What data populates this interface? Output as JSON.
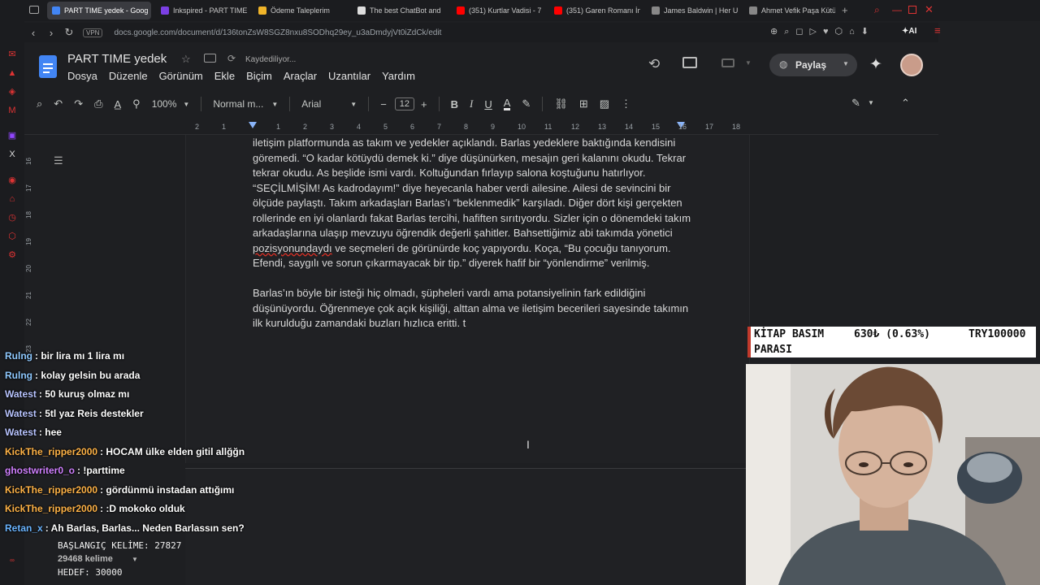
{
  "tabs": [
    {
      "label": "PART TIME yedek - Goog",
      "color": "#4285f4",
      "active": true
    },
    {
      "label": "Inkspired - PART TIME",
      "color": "#7b3fe4",
      "active": false
    },
    {
      "label": "Ödeme Taleplerim",
      "color": "#f0b429",
      "active": false
    },
    {
      "label": "The best ChatBot and",
      "color": "#dddddd",
      "active": false
    },
    {
      "label": "(351) Kurtlar Vadisi - 7",
      "color": "#ff0000",
      "active": false
    },
    {
      "label": "(351) Garen Romanı İn",
      "color": "#ff0000",
      "active": false
    },
    {
      "label": "James Baldwin | Her U",
      "color": "#888888",
      "active": false
    },
    {
      "label": "Ahmet Vefik Paşa Kütü",
      "color": "#888888",
      "active": false
    }
  ],
  "address": {
    "vpn": "VPN",
    "url": "docs.google.com/document/d/136tonZsW8SGZ8nxu8SODhq29ey_u3aDmdyjVt0iZdCk/edit"
  },
  "docs": {
    "title": "PART TIME  yedek",
    "saving": "Kaydediliyor...",
    "menus": [
      "Dosya",
      "Düzenle",
      "Görünüm",
      "Ekle",
      "Biçim",
      "Araçlar",
      "Uzantılar",
      "Yardım"
    ],
    "share": "Paylaş",
    "zoom": "100%",
    "style": "Normal m...",
    "font": "Arial",
    "fontsize": "12"
  },
  "ruler": [
    "2",
    "1",
    "1",
    "2",
    "3",
    "4",
    "5",
    "6",
    "7",
    "8",
    "9",
    "10",
    "11",
    "12",
    "13",
    "14",
    "15",
    "16",
    "17",
    "18"
  ],
  "vruler": [
    "16",
    "17",
    "18",
    "19",
    "20",
    "21",
    "22",
    "23"
  ],
  "text": {
    "p1": "iletişim platformunda as takım ve yedekler açıklandı. Barlas yedeklere baktığında kendisini göremedi. “O kadar kötüydü demek ki.” diye düşünürken, mesajın geri kalanını okudu. Tekrar tekrar okudu. As beşlide ismi vardı. Koltuğundan fırlayıp salona koştuğunu hatırlıyor. “SEÇİLMİŞİM! As kadrodayım!” diye heyecanla haber verdi ailesine. Ailesi de sevincini bir ölçüde paylaştı. Takım arkadaşları Barlas’ı “beklenmedik” karşıladı. Diğer dört kişi gerçekten rollerinde en iyi olanlardı fakat Barlas tercihi, hafiften sırıtıyordu. Sizler için o dönemdeki takım arkadaşlarına ulaşıp mevzuyu öğrendik değerli şahitler. Bahsettiğimiz abi takımda yönetici",
    "p1_squiggle": "pozisyonundaydı",
    "p1_rest": " ve seçmeleri de görünürde koç yapıyordu. Koça, “Bu çocuğu tanıyorum. Efendi, saygılı ve sorun çıkarmayacak bir tip.” diyerek hafif bir “yönlendirme” verilmiş.",
    "p2": "Barlas’ın böyle bir isteği hiç olmadı, şüpheleri vardı ama potansiyelinin fark edildiğini düşünüyordu. Öğrenmeye çok açık kişiliği, alttan alma ve iletişim becerileri sayesinde takımın ilk kurulduğu zamandaki buzları hızlıca eritti. t"
  },
  "chat": [
    {
      "user": "Rulng",
      "color": "#8fc9ff",
      "msg": ": bir lira mı 1 lira mı"
    },
    {
      "user": "Rulng",
      "color": "#8fc9ff",
      "msg": ": kolay gelsin bu arada"
    },
    {
      "user": "Watest",
      "color": "#b8c4ff",
      "msg": ": 50 kuruş olmaz mı"
    },
    {
      "user": "Watest",
      "color": "#b8c4ff",
      "msg": ": 5tl yaz Reis destekler"
    },
    {
      "user": "Watest",
      "color": "#b8c4ff",
      "msg": ": hee"
    },
    {
      "user": "KickThe_ripper2000",
      "color": "#ffb347",
      "msg": ": HOCAM ülke elden gitil allğğn"
    },
    {
      "user": "ghostwriter0_o",
      "color": "#d080ff",
      "msg": ": !parttime"
    },
    {
      "user": "KickThe_ripper2000",
      "color": "#ffb347",
      "msg": ": gördünmü instadan attığımı"
    },
    {
      "user": "KickThe_ripper2000",
      "color": "#ffb347",
      "msg": ": :D mokoko olduk"
    },
    {
      "user": "Retan_x",
      "color": "#6ab4ff",
      "msg": ": Ah Barlas, Barlas... Neden Barlassın sen?"
    }
  ],
  "counter": {
    "start": "BAŞLANGIÇ KELİME: 27827",
    "words": "29468 kelime",
    "target": "HEDEF: 30000"
  },
  "ticker": {
    "left": "KİTAP BASIM",
    "mid": "630₺ (0.63%)",
    "right": "TRY100000",
    "second": "PARASI"
  }
}
